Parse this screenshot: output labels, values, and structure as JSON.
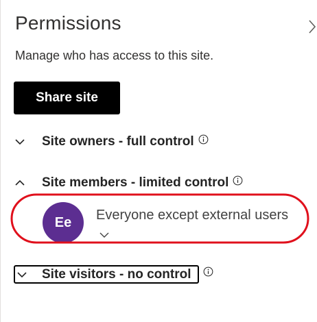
{
  "header": {
    "title": "Permissions",
    "subtitle": "Manage who has access to this site."
  },
  "actions": {
    "share_label": "Share site"
  },
  "groups": [
    {
      "label": "Site owners - full control",
      "expanded": false
    },
    {
      "label": "Site members - limited control",
      "expanded": true,
      "members": [
        {
          "initials": "Ee",
          "name": "Everyone except external users",
          "avatar_color": "#5c2e91"
        }
      ]
    },
    {
      "label": "Site visitors - no control",
      "expanded": false,
      "focused": true
    }
  ],
  "annotation": {
    "highlight_color": "#e0101c"
  },
  "icons": [
    "chevron-right-icon",
    "chevron-down-icon",
    "chevron-up-icon",
    "info-icon"
  ]
}
